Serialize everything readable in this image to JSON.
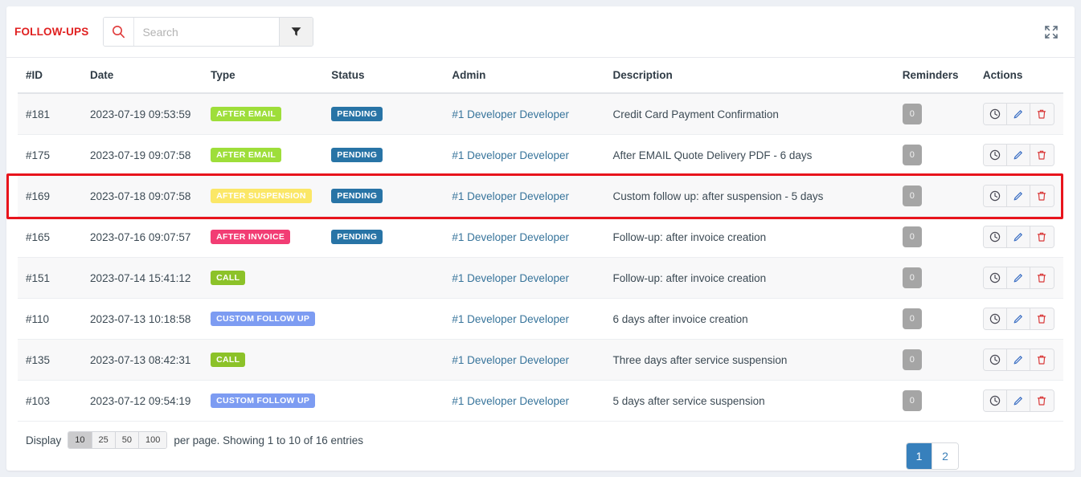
{
  "toolbar": {
    "panel_title": "FOLLOW-UPS",
    "search_placeholder": "Search",
    "search_value": "",
    "search_icon": "search-icon",
    "filter_icon": "filter-funnel-icon",
    "expand_icon": "expand-fullscreen-icon"
  },
  "table": {
    "columns": [
      {
        "key": "id",
        "label": "#ID"
      },
      {
        "key": "date",
        "label": "Date"
      },
      {
        "key": "type",
        "label": "Type"
      },
      {
        "key": "status",
        "label": "Status"
      },
      {
        "key": "admin",
        "label": "Admin"
      },
      {
        "key": "description",
        "label": "Description"
      },
      {
        "key": "reminders",
        "label": "Reminders"
      },
      {
        "key": "actions",
        "label": "Actions"
      }
    ],
    "rows": [
      {
        "id": "#181",
        "date": "2023-07-19 09:53:59",
        "type": "AFTER EMAIL",
        "type_class": "badge-after-email",
        "status": "PENDING",
        "admin": "#1 Developer Developer",
        "description": "Credit Card Payment Confirmation",
        "reminders": "0",
        "highlighted": false
      },
      {
        "id": "#175",
        "date": "2023-07-19 09:07:58",
        "type": "AFTER EMAIL",
        "type_class": "badge-after-email",
        "status": "PENDING",
        "admin": "#1 Developer Developer",
        "description": "After EMAIL Quote Delivery PDF - 6 days",
        "reminders": "0",
        "highlighted": false
      },
      {
        "id": "#169",
        "date": "2023-07-18 09:07:58",
        "type": "AFTER SUSPENSION",
        "type_class": "badge-after-suspension",
        "status": "PENDING",
        "admin": "#1 Developer Developer",
        "description": "Custom follow up: after suspension - 5 days",
        "reminders": "0",
        "highlighted": true
      },
      {
        "id": "#165",
        "date": "2023-07-16 09:07:57",
        "type": "AFTER INVOICE",
        "type_class": "badge-after-invoice",
        "status": "PENDING",
        "admin": "#1 Developer Developer",
        "description": "Follow-up: after invoice creation",
        "reminders": "0",
        "highlighted": false
      },
      {
        "id": "#151",
        "date": "2023-07-14 15:41:12",
        "type": "CALL",
        "type_class": "badge-call",
        "status": "",
        "admin": "#1 Developer Developer",
        "description": "Follow-up: after invoice creation",
        "reminders": "0",
        "highlighted": false
      },
      {
        "id": "#110",
        "date": "2023-07-13 10:18:58",
        "type": "CUSTOM FOLLOW UP",
        "type_class": "badge-custom",
        "status": "",
        "admin": "#1 Developer Developer",
        "description": "6 days after invoice creation",
        "reminders": "0",
        "highlighted": false
      },
      {
        "id": "#135",
        "date": "2023-07-13 08:42:31",
        "type": "CALL",
        "type_class": "badge-call",
        "status": "",
        "admin": "#1 Developer Developer",
        "description": "Three days after service suspension",
        "reminders": "0",
        "highlighted": false
      },
      {
        "id": "#103",
        "date": "2023-07-12 09:54:19",
        "type": "CUSTOM FOLLOW UP",
        "type_class": "badge-custom",
        "status": "",
        "admin": "#1 Developer Developer",
        "description": "5 days after service suspension",
        "reminders": "0",
        "highlighted": false
      }
    ],
    "action_icons": [
      {
        "name": "clock-history-icon",
        "color": "#4a4a55"
      },
      {
        "name": "pencil-edit-icon",
        "color": "#3b6fc4"
      },
      {
        "name": "trash-delete-icon",
        "color": "#d93a3a"
      }
    ]
  },
  "footer": {
    "display_label": "Display",
    "page_lengths": [
      "10",
      "25",
      "50",
      "100"
    ],
    "active_length": "10",
    "per_page_text": "per page. Showing 1 to 10 of 16 entries",
    "pages": [
      "1",
      "2"
    ],
    "active_page": "1"
  },
  "colors": {
    "brand_red": "#e02020",
    "page_bg": "#edf0f5",
    "card_bg": "#ffffff",
    "link_blue": "#37749b",
    "highlight_border": "#e8141c",
    "pager_active": "#3780bc"
  }
}
